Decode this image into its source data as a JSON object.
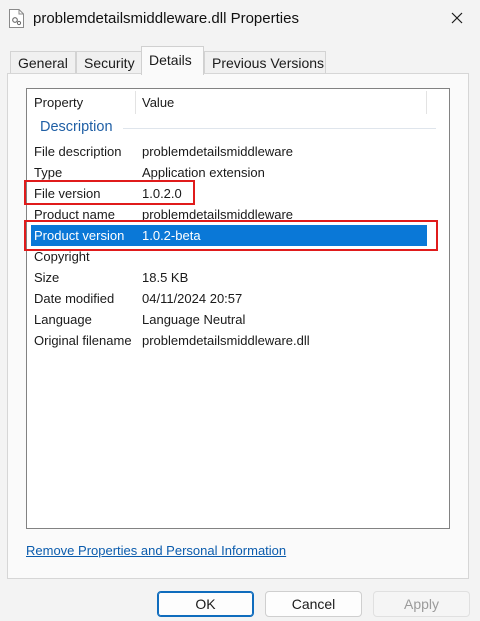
{
  "window": {
    "title": "problemdetailsmiddleware.dll Properties",
    "icon": "dll-file-icon",
    "close_glyph": "✕"
  },
  "tabs": [
    {
      "label": "General",
      "active": false
    },
    {
      "label": "Security",
      "active": false
    },
    {
      "label": "Details",
      "active": true
    },
    {
      "label": "Previous Versions",
      "active": false
    }
  ],
  "details": {
    "columns": {
      "property": "Property",
      "value": "Value"
    },
    "group_label": "Description",
    "rows": [
      {
        "key": "File description",
        "value": "problemdetailsmiddleware"
      },
      {
        "key": "Type",
        "value": "Application extension"
      },
      {
        "key": "File version",
        "value": "1.0.2.0"
      },
      {
        "key": "Product name",
        "value": "problemdetailsmiddleware"
      },
      {
        "key": "Product version",
        "value": "1.0.2-beta",
        "selected": true
      },
      {
        "key": "Copyright",
        "value": ""
      },
      {
        "key": "Size",
        "value": "18.5 KB"
      },
      {
        "key": "Date modified",
        "value": "04/11/2024 20:57"
      },
      {
        "key": "Language",
        "value": "Language Neutral"
      },
      {
        "key": "Original filename",
        "value": "problemdetailsmiddleware.dll"
      }
    ]
  },
  "link": {
    "label": "Remove Properties and Personal Information"
  },
  "buttons": {
    "ok": "OK",
    "cancel": "Cancel",
    "apply": "Apply"
  },
  "colors": {
    "selection": "#0a78d7",
    "highlight_box": "#e01b1b",
    "group_text": "#1f5fa5",
    "link": "#0b5cad"
  }
}
